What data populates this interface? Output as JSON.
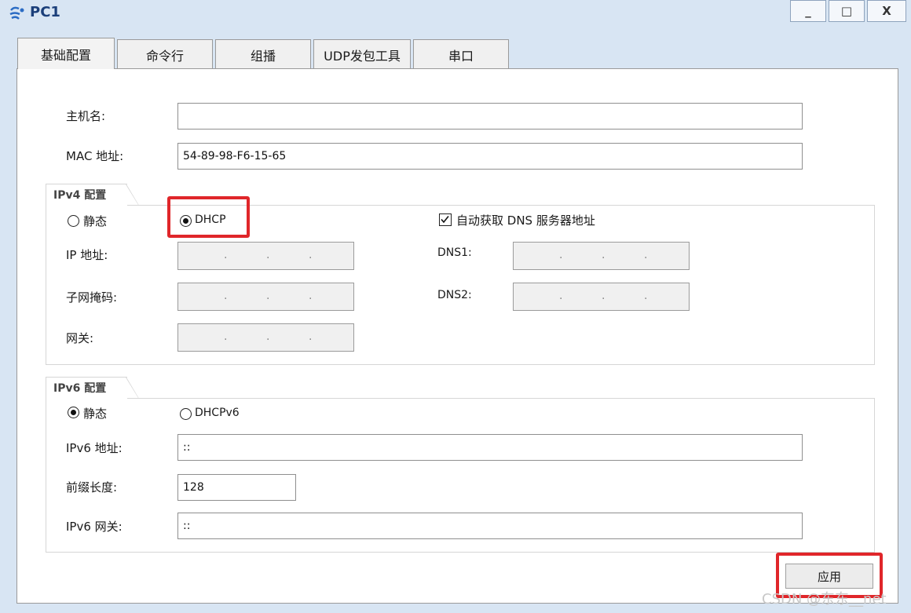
{
  "window": {
    "title": "PC1",
    "controls": {
      "minimize": "_",
      "maximize": "□",
      "close": "X"
    }
  },
  "tabs": [
    {
      "label": "基础配置",
      "active": true
    },
    {
      "label": "命令行",
      "active": false
    },
    {
      "label": "组播",
      "active": false
    },
    {
      "label": "UDP发包工具",
      "active": false
    },
    {
      "label": "串口",
      "active": false
    }
  ],
  "basic": {
    "hostname_label": "主机名:",
    "hostname_value": "",
    "mac_label": "MAC 地址:",
    "mac_value": "54-89-98-F6-15-65"
  },
  "ipv4": {
    "group_title": "IPv4 配置",
    "static_label": "静态",
    "dhcp_label": "DHCP",
    "selected": "DHCP",
    "auto_dns_label": "自动获取 DNS 服务器地址",
    "auto_dns_checked": true,
    "ip_label": "IP 地址:",
    "mask_label": "子网掩码:",
    "gateway_label": "网关:",
    "dns1_label": "DNS1:",
    "dns2_label": "DNS2:",
    "ip_dots": "."
  },
  "ipv6": {
    "group_title": "IPv6 配置",
    "static_label": "静态",
    "dhcpv6_label": "DHCPv6",
    "selected": "静态",
    "address_label": "IPv6 地址:",
    "address_value": "::",
    "prefix_label": "前缀长度:",
    "prefix_value": "128",
    "gateway_label": "IPv6 网关:",
    "gateway_value": "::"
  },
  "apply_label": "应用",
  "watermark": "CSDN @东东__net",
  "colors": {
    "highlight": "#e0262a",
    "title": "#1b3f7a",
    "background": "#d8e5f3"
  }
}
